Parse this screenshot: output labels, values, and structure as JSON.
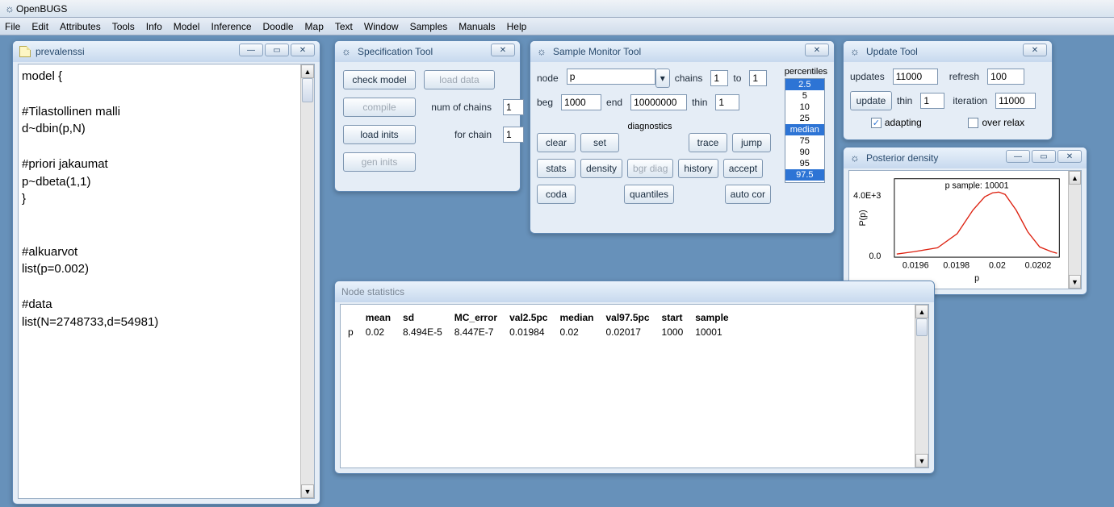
{
  "app_title": "OpenBUGS",
  "menus": [
    "File",
    "Edit",
    "Attributes",
    "Tools",
    "Info",
    "Model",
    "Inference",
    "Doodle",
    "Map",
    "Text",
    "Window",
    "Samples",
    "Manuals",
    "Help"
  ],
  "editor": {
    "title": "prevalenssi",
    "content": "model {\n\n#Tilastollinen malli\nd~dbin(p,N)\n\n#priori jakaumat\np~dbeta(1,1)\n}\n\n\n#alkuarvot\nlist(p=0.002)\n\n#data\nlist(N=2748733,d=54981)"
  },
  "spec": {
    "title": "Specification Tool",
    "check_model": "check model",
    "load_data": "load data",
    "compile": "compile",
    "num_chains_label": "num of chains",
    "num_chains": "1",
    "load_inits": "load inits",
    "for_chain_label": "for chain",
    "for_chain": "1",
    "gen_inits": "gen inits"
  },
  "monitor": {
    "title": "Sample Monitor Tool",
    "node_label": "node",
    "node": "p",
    "chains_label": "chains",
    "chains_from": "1",
    "to_label": "to",
    "chains_to": "1",
    "beg_label": "beg",
    "beg": "1000",
    "end_label": "end",
    "end": "10000000",
    "thin_label": "thin",
    "thin": "1",
    "percentiles_label": "percentiles",
    "percentiles": [
      "2.5",
      "5",
      "10",
      "25",
      "median",
      "75",
      "90",
      "95",
      "97.5"
    ],
    "percentiles_selected": [
      "2.5",
      "median",
      "97.5"
    ],
    "diagnostics_label": "diagnostics",
    "btns": {
      "clear": "clear",
      "set": "set",
      "trace": "trace",
      "jump": "jump",
      "stats": "stats",
      "density": "density",
      "bgr": "bgr diag",
      "history": "history",
      "accept": "accept",
      "coda": "coda",
      "quantiles": "quantiles",
      "autocor": "auto cor"
    }
  },
  "update": {
    "title": "Update Tool",
    "updates_label": "updates",
    "updates": "11000",
    "refresh_label": "refresh",
    "refresh": "100",
    "update_btn": "update",
    "thin_label": "thin",
    "thin": "1",
    "iteration_label": "iteration",
    "iteration": "11000",
    "adapting_label": "adapting",
    "adapting": true,
    "overrelax_label": "over relax",
    "overrelax": false
  },
  "posterior": {
    "title": "Posterior density",
    "sample_label": "p sample: 10001",
    "y_label": "P(p)",
    "y_ticks": [
      "0.0",
      "4.0E+3"
    ],
    "x_label": "p",
    "x_ticks": [
      "0.0196",
      "0.0198",
      "0.02",
      "0.0202"
    ]
  },
  "chart_data": {
    "type": "line",
    "title": "p sample: 10001",
    "xlabel": "p",
    "ylabel": "P(p)",
    "xlim": [
      0.0195,
      0.0204
    ],
    "ylim": [
      0,
      4800
    ],
    "x": [
      0.0195,
      0.0196,
      0.0197,
      0.0198,
      0.0199,
      0.02,
      0.0201,
      0.0202,
      0.0203,
      0.0204
    ],
    "values": [
      50,
      150,
      700,
      2000,
      3700,
      4600,
      3600,
      1800,
      500,
      80
    ]
  },
  "stats": {
    "title": "Node statistics",
    "headers": [
      "",
      "mean",
      "sd",
      "MC_error",
      "val2.5pc",
      "median",
      "val97.5pc",
      "start",
      "sample"
    ],
    "rows": [
      [
        "p",
        "0.02",
        "8.494E-5",
        "8.447E-7",
        "0.01984",
        "0.02",
        "0.02017",
        "1000",
        "10001"
      ]
    ]
  }
}
